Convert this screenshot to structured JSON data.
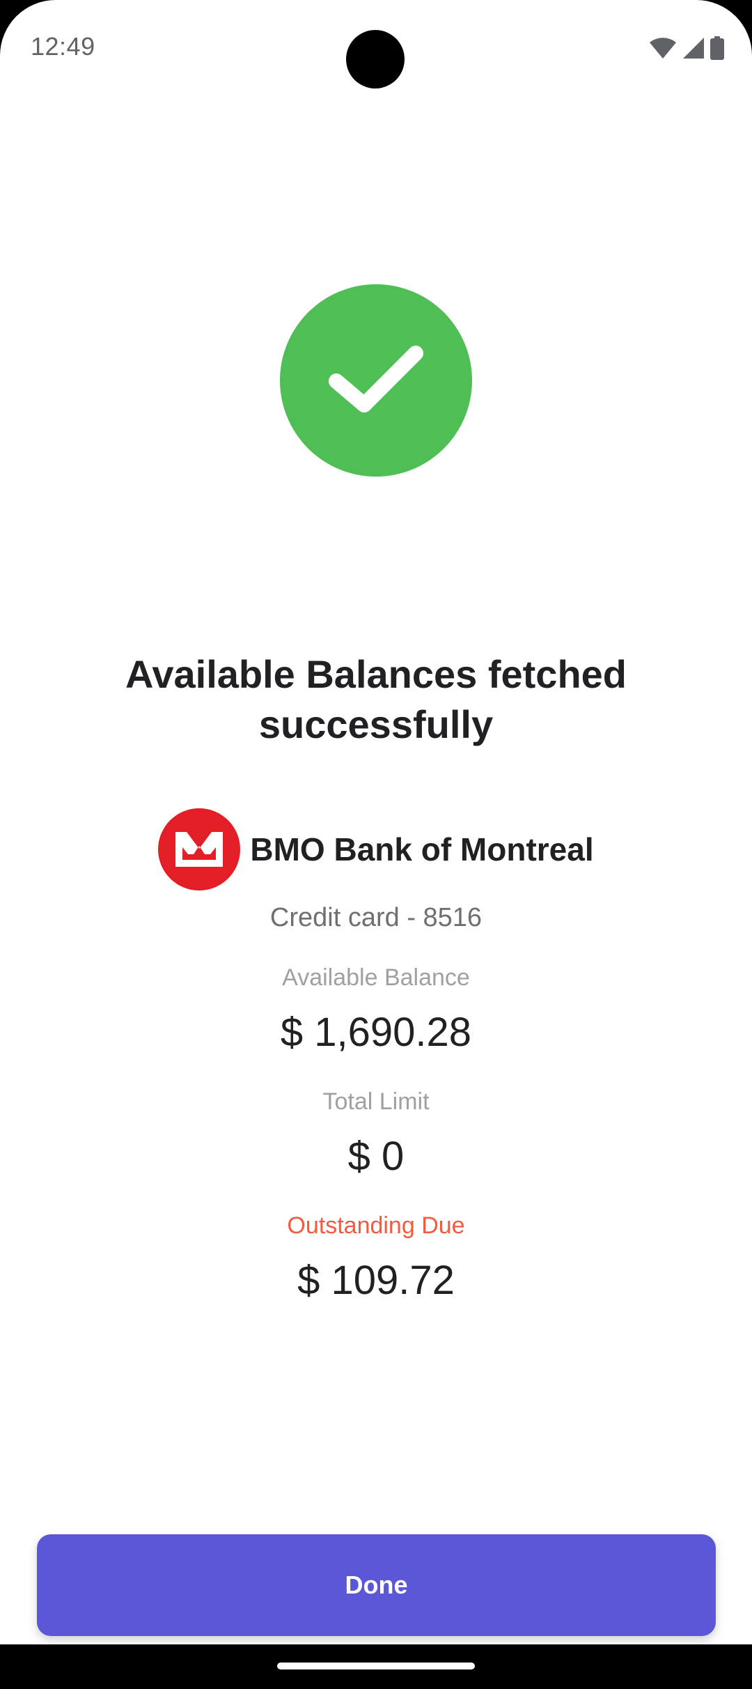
{
  "status_bar": {
    "time": "12:49",
    "icons": [
      "wifi-icon",
      "signal-icon",
      "battery-icon"
    ]
  },
  "success": {
    "icon": "check-icon",
    "color": "#4fbf55",
    "title": "Available Balances fetched successfully"
  },
  "bank": {
    "logo": "bmo-logo",
    "logo_color": "#e41e26",
    "name": "BMO Bank of Montreal",
    "account": "Credit card - 8516"
  },
  "balances": {
    "available_label": "Available Balance",
    "available_value": "$ 1,690.28",
    "limit_label": "Total Limit",
    "limit_value": "$ 0",
    "due_label": "Outstanding Due",
    "due_value": "$ 109.72",
    "due_color": "#f25b40"
  },
  "actions": {
    "done_label": "Done",
    "button_color": "#5b57d6"
  }
}
